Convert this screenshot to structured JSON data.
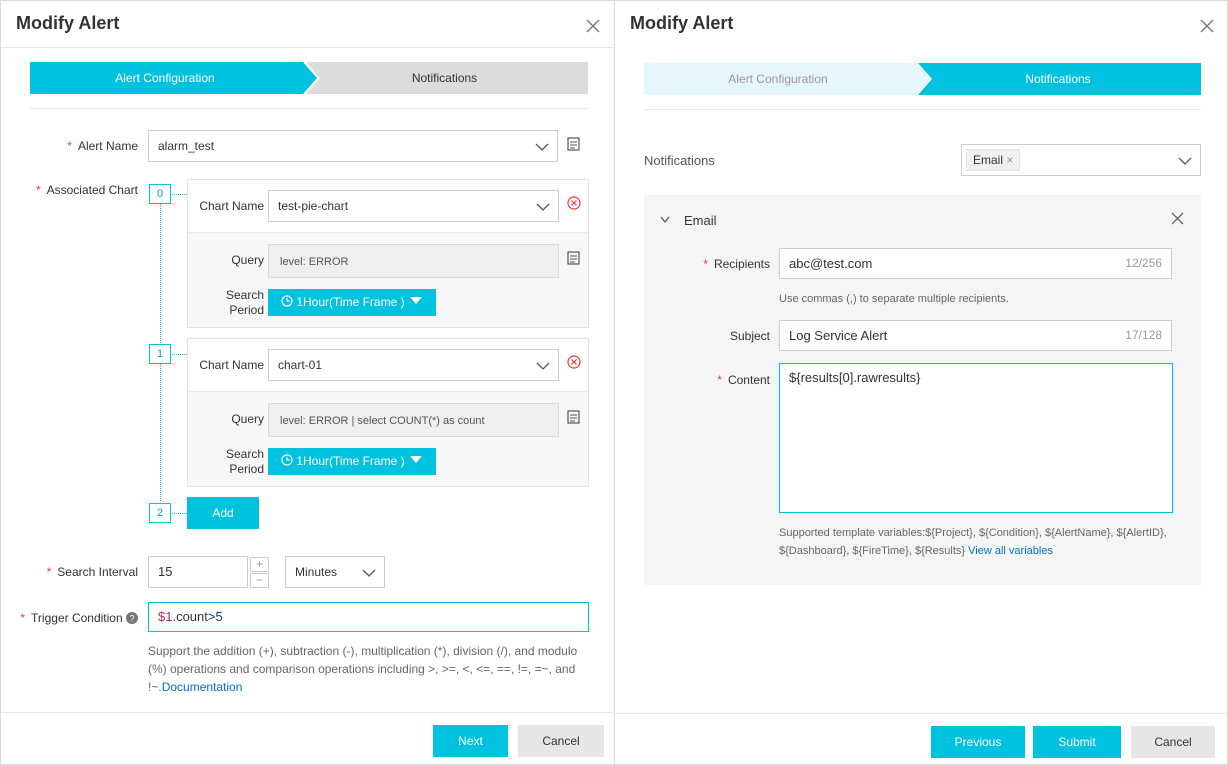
{
  "left": {
    "title": "Modify Alert",
    "close": "✕",
    "steps": [
      "Alert Configuration",
      "Notifications"
    ],
    "alert_name_label": "Alert Name",
    "alert_name_value": "alarm_test",
    "associated_chart_label": "Associated Chart",
    "charts": [
      {
        "index": "0",
        "chart_name_label": "Chart Name",
        "chart_name": "test-pie-chart",
        "query_label": "Query",
        "query": "level: ERROR",
        "period_label_1": "Search",
        "period_label_2": "Period",
        "period": "1Hour(Time Frame )"
      },
      {
        "index": "1",
        "chart_name_label": "Chart Name",
        "chart_name": "chart-01",
        "query_label": "Query",
        "query": "level: ERROR | select COUNT(*) as count",
        "period_label_1": "Search",
        "period_label_2": "Period",
        "period": "1Hour(Time Frame )"
      }
    ],
    "next_index": "2",
    "add_label": "Add",
    "search_interval_label": "Search Interval",
    "search_interval_value": "15",
    "interval_unit": "Minutes",
    "plus": "+",
    "minus": "−",
    "trigger_label": "Trigger Condition",
    "trigger_prefix": "$1",
    "trigger_mid": ".count",
    "trigger_suffix": ">5",
    "trigger_help": "Support the addition (+), subtraction (-), multiplication (*), division (/), and modulo (%) operations and comparison operations including >, >=, <, <=, ==, !=, =~, and !~.",
    "doc_link": "Documentation",
    "next_label": "Next",
    "cancel_label": "Cancel"
  },
  "right": {
    "title": "Modify Alert",
    "close": "✕",
    "steps": [
      "Alert Configuration",
      "Notifications"
    ],
    "notifications_label": "Notifications",
    "notification_tag": "Email",
    "tag_remove": "×",
    "email_section_label": "Email",
    "recipients_label": "Recipients",
    "recipients_value": "abc@test.com",
    "recipients_count": "12/256",
    "recipients_help": "Use commas (,) to separate multiple recipients.",
    "subject_label": "Subject",
    "subject_value": "Log Service Alert",
    "subject_count": "17/128",
    "content_label": "Content",
    "content_value": "${results[0].rawresults}",
    "template_help": "Supported template variables:${Project}, ${Condition}, ${AlertName}, ${AlertID}, ${Dashboard}, ${FireTime}, ${Results}",
    "view_all": "View all variables",
    "previous_label": "Previous",
    "submit_label": "Submit",
    "cancel_label": "Cancel"
  },
  "colors": {
    "accent": "#00c1de",
    "required": "#e4393c",
    "link": "#0070cc",
    "step_inactive": "#dcdcdc",
    "step_inactive_light": "#e6f7fb"
  }
}
